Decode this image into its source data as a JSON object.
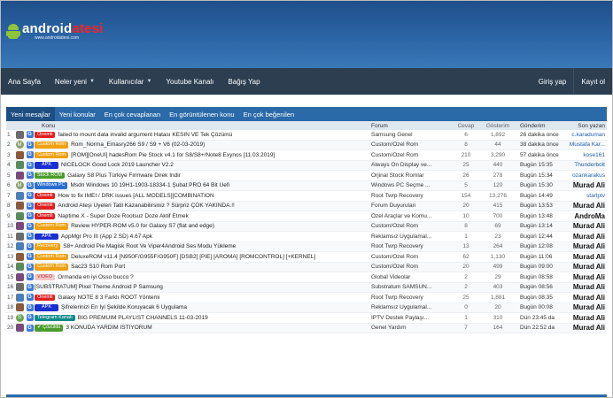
{
  "header": {
    "logo_part1": "android",
    "logo_part2": "atesi",
    "logo_url": "www.androidatesi.com"
  },
  "nav": {
    "left": [
      {
        "label": "Ana Sayfa",
        "caret": false
      },
      {
        "label": "Neler yeni",
        "caret": true
      },
      {
        "label": "Kullanıcılar",
        "caret": true
      },
      {
        "label": "Youtube Kanalı",
        "caret": false
      },
      {
        "label": "Bağış Yap",
        "caret": false
      }
    ],
    "login": "Giriş yap",
    "register": "Kayıt ol"
  },
  "tabs": [
    {
      "label": "Yeni mesajlar",
      "active": true
    },
    {
      "label": "Yeni konular",
      "active": false
    },
    {
      "label": "En çok cevaplanan",
      "active": false
    },
    {
      "label": "En görüntülenen konu",
      "active": false
    },
    {
      "label": "En çok beğenilen",
      "active": false
    }
  ],
  "columns": {
    "konu": "Konu",
    "forum": "Forum",
    "cevap": "Cevap",
    "gosterim": "Gösterim",
    "gonderim": "Gönderim",
    "son_yazan": "Son yazan"
  },
  "colors": {
    "red": "#e02020",
    "orange": "#f0a010",
    "apk": "#1a2fd0",
    "green": "#4a9c2a",
    "blue": "#2a6fd0",
    "teal": "#0f8a8a",
    "video": "#f3c6c6"
  },
  "rows": [
    {
      "num": "1",
      "avatar": "img",
      "tag": "Önemli",
      "tag_color": "red",
      "title": "failed to mount data invalid argument Hatası KESIN VE Tek Çözümü",
      "forum": "Samsung Genel",
      "cevap": "6",
      "gosterim": "1,892",
      "gonderim": "26 dakika once",
      "son": "c.karaduman",
      "bold": false
    },
    {
      "num": "2",
      "avatar": "M",
      "tag": "Custom Rom",
      "tag_color": "orange",
      "title": "Rom_Norma_Emasry266 S9 / S9 + V6 (02-03-2019)",
      "forum": "Custom/Özel Rom",
      "cevap": "8",
      "gosterim": "44",
      "gonderim": "38 dakika önce",
      "son": "Mustafa Kar...",
      "bold": false
    },
    {
      "num": "3",
      "avatar": "img",
      "tag": "Custom Rom",
      "tag_color": "orange",
      "title": "[ROM][OneUI] hadesRom Pie Stock v4.1 for S8/S8+/Note8 Exynos [11.03.2019]",
      "forum": "Custom/Özel Rom",
      "cevap": "210",
      "gosterim": "3,290",
      "gonderim": "57 dakika önce",
      "son": "kose161",
      "bold": false
    },
    {
      "num": "4",
      "avatar": "img",
      "tag": "APK",
      "tag_color": "apk",
      "title": "NICELOCK Good Lock 2019 Launcher V2.2",
      "forum": "Always On Display ve...",
      "cevap": "25",
      "gosterim": "440",
      "gonderim": "Bugün 15:35",
      "son": "Thunderbolt",
      "bold": false
    },
    {
      "num": "5",
      "avatar": "img",
      "tag": "Stock ROM",
      "tag_color": "green",
      "title": "Galaxy S8 Plus Türkiye Firmware Direk İndir",
      "forum": "Orjinal Stock Romlar",
      "cevap": "26",
      "gosterim": "278",
      "gonderim": "Bugün 15:34",
      "son": "ozankarakus",
      "bold": false
    },
    {
      "num": "6",
      "avatar": "M",
      "tag": "Windows PC",
      "tag_color": "blue",
      "title": "Msdn Windows 10 19H1-1903-18334-1 Şubat PRO 64 Bit Uefi",
      "forum": "Windows PC Seçme ...",
      "cevap": "5",
      "gosterim": "120",
      "gonderim": "Bugün 15:30",
      "son": "Murad Ali",
      "bold": true
    },
    {
      "num": "7",
      "avatar": "img",
      "tag": "Önemli",
      "tag_color": "red",
      "title": "How to fix IMEI / DRK issues [ALL MODELS][COMBINATION",
      "forum": "Root Twrp Recovery",
      "cevap": "154",
      "gosterim": "13,276",
      "gonderim": "Bugün 14:49",
      "son": "starlptv",
      "bold": false
    },
    {
      "num": "8",
      "avatar": "img",
      "tag": "Önemli",
      "tag_color": "red",
      "title": "Android Ateşi Üyeleri Tatil Kazanabilirsiniz ? Sürpriz ÇOK YAKINDA.!!",
      "forum": "Forum Duyuruları",
      "cevap": "20",
      "gosterim": "415",
      "gonderim": "Bugün 13:53",
      "son": "Murad Ali",
      "bold": true
    },
    {
      "num": "9",
      "avatar": "img",
      "tag": "Önemli",
      "tag_color": "red",
      "title": "Naptime X - Super Doze Rootsuz Doze Aktif Etmek",
      "forum": "Özel Araçlar ve Komu...",
      "cevap": "10",
      "gosterim": "700",
      "gonderim": "Bugün 13:48",
      "son": "AndroMa",
      "bold": true
    },
    {
      "num": "10",
      "avatar": "img",
      "tag": "Custom Rom",
      "tag_color": "orange",
      "title": "Review HYPER-ROM v5.0 for Galaxy S7 (flat and edge)",
      "forum": "Custom/Özel Rom",
      "cevap": "8",
      "gosterim": "69",
      "gonderim": "Bugün 13:14",
      "son": "Murad Ali",
      "bold": true
    },
    {
      "num": "11",
      "avatar": "img",
      "tag": "APK",
      "tag_color": "apk",
      "title": "AppMgr Pro III (App 2 SD) 4.67 Apk",
      "forum": "Reklamsız Uygulamal...",
      "cevap": "1",
      "gosterim": "23",
      "gonderim": "Bugün 12:44",
      "son": "Murad Ali",
      "bold": true
    },
    {
      "num": "12",
      "avatar": "img",
      "tag": "Recovery",
      "tag_color": "orange",
      "title": "S8+ Android Pie Magisk Root Ve Viper4Android Ses Modu Yükleme",
      "forum": "Root Twrp Recovery",
      "cevap": "13",
      "gosterim": "264",
      "gonderim": "Bugün 12:08",
      "son": "Murad Ali",
      "bold": true
    },
    {
      "num": "13",
      "avatar": "img",
      "tag": "Custom Rom",
      "tag_color": "orange",
      "title": "DeluxeROM v11.4 [N950F/G955F/G950F] [DSB2] [PIE] [AROMA] [ROMCONTROL] [+KERNEL]",
      "forum": "Custom/Özel Rom",
      "cevap": "62",
      "gosterim": "1,130",
      "gonderim": "Bugün 11:06",
      "son": "Murad Ali",
      "bold": true
    },
    {
      "num": "14",
      "avatar": "img",
      "tag": "Custom Rom",
      "tag_color": "orange",
      "title": "Sac23 S10 Rom Port",
      "forum": "Custom/Özel Rom",
      "cevap": "20",
      "gosterim": "499",
      "gonderim": "Bugün 09:00",
      "son": "Murad Ali",
      "bold": true
    },
    {
      "num": "15",
      "avatar": "img",
      "tag": "VIDEO",
      "tag_color": "video",
      "title": "Ormanda en iyi Osso bucco ?",
      "forum": "Global Videolar",
      "cevap": "2",
      "gosterim": "29",
      "gonderim": "Bugün 08:58",
      "son": "Murad Ali",
      "bold": true
    },
    {
      "num": "16",
      "avatar": "img",
      "tag": "",
      "tag_color": "",
      "title": "[SUBSTRATUM] Pixel Theme Android P Samsung",
      "forum": "Substratum SAMSUN...",
      "cevap": "2",
      "gosterim": "403",
      "gonderim": "Bugün 08:56",
      "son": "Murad Ali",
      "bold": true
    },
    {
      "num": "17",
      "avatar": "img",
      "tag": "Önemli",
      "tag_color": "red",
      "title": "Galaxy NOTE 8 3 Farklı ROOT Yöntemi",
      "forum": "Root Twrp Recovery",
      "cevap": "25",
      "gosterim": "1,881",
      "gonderim": "Bugün 08:35",
      "son": "Murad Ali",
      "bold": true
    },
    {
      "num": "18",
      "avatar": "img",
      "tag": "APK",
      "tag_color": "apk",
      "title": "Şifrelerinizi En İyi Şekilde Koruyacak 6 Uygulama",
      "forum": "Reklamsız Uygulamal...",
      "cevap": "0",
      "gosterim": "20",
      "gonderim": "Bugün 00:08",
      "son": "Murad Ali",
      "bold": true
    },
    {
      "num": "19",
      "avatar": "S",
      "tag": "Telegram Kanalı",
      "tag_color": "teal",
      "title": "BIG PREMUIM PLAYLIST CHANNELS 11-03-2019",
      "forum": "IPTV Destek Paylaşı...",
      "cevap": "1",
      "gosterim": "310",
      "gonderim": "Dün 23:45 da",
      "son": "Murad Ali",
      "bold": true
    },
    {
      "num": "20",
      "avatar": "img",
      "tag": "✔ Çözüldü",
      "tag_color": "green",
      "title": "3 KONUDA YARDIM İSTİYORUM",
      "forum": "Genel Yardım",
      "cevap": "7",
      "gosterim": "164",
      "gonderim": "Dün 22:52 da",
      "son": "Murad Ali",
      "bold": true
    }
  ]
}
